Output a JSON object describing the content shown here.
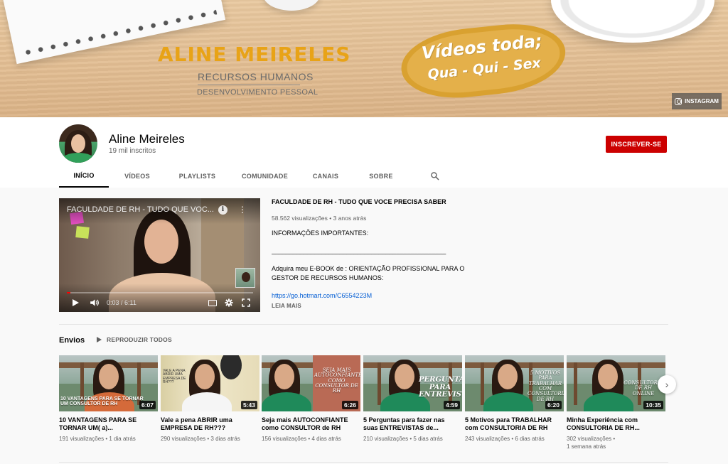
{
  "banner": {
    "name": "ALINE MEIRELES",
    "subtitle1": "RECURSOS HUMANOS",
    "subtitle2": "DESENVOLVIMENTO PESSOAL",
    "badge_line1": "Vídeos toda;",
    "badge_line2": "Qua - Qui - Sex",
    "instagram_label": "INSTAGRAM"
  },
  "channel": {
    "name": "Aline Meireles",
    "subscribers": "19 mil inscritos",
    "subscribe_label": "INSCREVER-SE"
  },
  "tabs": [
    {
      "label": "INÍCIO",
      "active": true
    },
    {
      "label": "VÍDEOS",
      "active": false
    },
    {
      "label": "PLAYLISTS",
      "active": false
    },
    {
      "label": "COMUNIDADE",
      "active": false
    },
    {
      "label": "CANAIS",
      "active": false
    },
    {
      "label": "SOBRE",
      "active": false
    }
  ],
  "featured": {
    "player_title": "FACULDADE DE RH - TUDO QUE VOC...",
    "time": "0:03 / 6:11",
    "progress": 0.008,
    "title": "FACULDADE DE RH - TUDO QUE VOCE PRECISA SABER",
    "meta": "58.562 visualizações • 3 anos atrás",
    "desc": {
      "line1": "INFORMAÇÕES IMPORTANTES:",
      "line2": "_________________________________________________",
      "line3": "Adquira meu E-BOOK de : ORIENTAÇÃO PROFISSIONAL PARA O GESTOR DE RECURSOS HUMANOS:",
      "link": "https://go.hotmart.com/C6554223M"
    },
    "read_more": "LEIA MAIS"
  },
  "shelf": {
    "title": "Envios",
    "play_all": "REPRODUZIR TODOS",
    "videos": [
      {
        "title": "10 VANTAGENS PARA SE TORNAR UM( a)...",
        "views": "191 visualizações",
        "age": "1 dia atrás",
        "duration": "6:07",
        "thumb_text": "10 VANTAGENS PARA SE TORNAR UM CONSULTOR DE RH"
      },
      {
        "title": "Vale a pena ABRIR uma EMPRESA DE RH???",
        "views": "290 visualizações",
        "age": "3 dias atrás",
        "duration": "5:43",
        "thumb_text": "VALE A PENA ABRIR UMA EMPRESA DE RH???"
      },
      {
        "title": "Seja mais AUTOCONFIANTE como CONSULTOR de RH",
        "views": "156 visualizações",
        "age": "4 dias atrás",
        "duration": "6:26",
        "thumb_text": "SEJA MAIS AUTOCONFIANTE COMO CONSULTOR DE RH"
      },
      {
        "title": "5 Perguntas para fazer nas suas ENTREVISTAS de...",
        "views": "210 visualizações",
        "age": "5 dias atrás",
        "duration": "4:59",
        "thumb_text": "PERGUNTAS PARA ENTREVISTAS"
      },
      {
        "title": "5 Motivos para TRABALHAR com CONSULTORIA DE RH",
        "views": "243 visualizações",
        "age": "6 dias atrás",
        "duration": "6:20",
        "thumb_text": "5 MOTIVOS PARA TRABALHAR COM CONSULTORIA DE RH"
      },
      {
        "title": "Minha Experiência com CONSULTORIA DE RH...",
        "views": "302 visualizações",
        "age": "1 semana atrás",
        "duration": "10:35",
        "thumb_text": "CONSULTORIA DE RH ONLINE"
      }
    ]
  },
  "icons": {
    "search": "search-icon",
    "next": "chevron-right-icon"
  }
}
